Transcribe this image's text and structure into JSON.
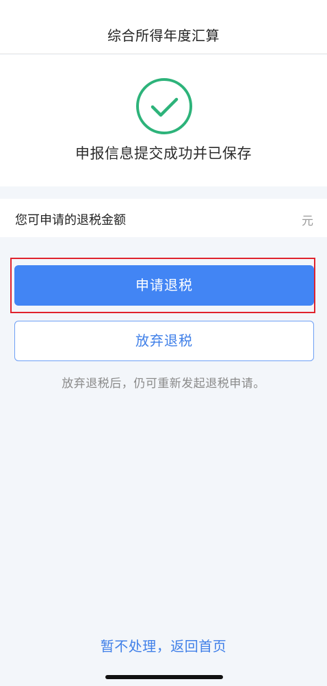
{
  "header": {
    "title": "综合所得年度汇算"
  },
  "success": {
    "icon": "check-circle-icon",
    "message": "申报信息提交成功并已保存",
    "icon_color": "#2db37a"
  },
  "refund": {
    "label": "您可申请的退税金额",
    "unit": "元"
  },
  "actions": {
    "apply_label": "申请退税",
    "giveup_label": "放弃退税",
    "hint": "放弃退税后，仍可重新发起退税申请。",
    "back_label": "暂不处理，返回首页"
  },
  "colors": {
    "primary": "#4285f4",
    "link": "#3f7fe8",
    "highlight": "#e0222c",
    "background": "#f3f6fa"
  }
}
